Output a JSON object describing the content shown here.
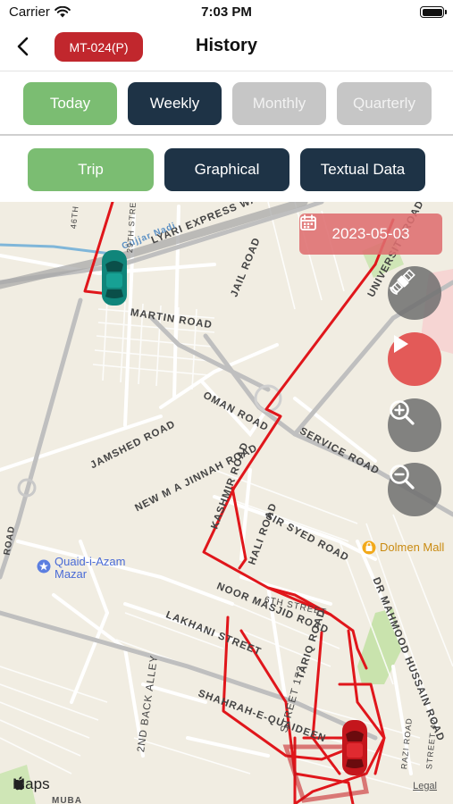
{
  "status_bar": {
    "carrier": "Carrier",
    "time": "7:03 PM"
  },
  "nav": {
    "vehicle_id": "MT-024(P)",
    "title": "History"
  },
  "period_tabs": [
    "Today",
    "Weekly",
    "Monthly",
    "Quarterly"
  ],
  "mode_tabs": [
    "Trip",
    "Graphical",
    "Textual Data"
  ],
  "map": {
    "date": "2023-05-03",
    "labels": {
      "lyari_expressway": "LYARI EXPRESS WAY",
      "martin_road": "MARTIN ROAD",
      "jail_road": "JAIL ROAD",
      "university_road": "UNIVERSITY ROAD",
      "oman_road": "OMAN ROAD",
      "service_road": "SERVICE ROAD",
      "jamshed_road": "JAMSHED ROAD",
      "new_ma_jinnah_road": "NEW M A JINNAH ROAD",
      "kashmir_road": "KASHMIR ROAD",
      "sir_syed_road": "SIR SYED ROAD",
      "hali_road": "HALI ROAD",
      "noor_masjid_road": "NOOR MASJID ROAD",
      "lakhani_street": "LAKHANI STREET",
      "tariq_road": "TARIQ ROAD",
      "street_173": "STREET 173",
      "dr_mahmood_hussain_road": "DR MAHMOOD HUSSAIN ROAD",
      "back_alley": "2ND BACK ALLEY",
      "shahrah": "SHAHRAH-E-QUAIDEEN",
      "twenty_ninth_street": "29TH STREET",
      "forty_sixth": "46TH",
      "road_a": "ROAD",
      "sixth_street": "6TH STREET",
      "razi_road": "RAZI ROAD",
      "street_42": "STREET 42",
      "mubarak": "MUBA",
      "nadi": "Gujjar Nadi"
    },
    "poi": {
      "mazar": "Quaid-i-Azam Mazar",
      "dolmen": "Dolmen Mall"
    },
    "attribution": {
      "maps": "Maps",
      "legal": "Legal"
    }
  },
  "colors": {
    "accent_red": "#c1272d",
    "active_green": "#7bbd72",
    "dark_navy": "#1e3346",
    "inactive_gray": "#c6c6c6",
    "track_red": "#e0161b",
    "vehicle_start": "#10857a",
    "vehicle_end": "#c4161c"
  },
  "icons": {
    "back": "chevron-left-icon",
    "calendar": "calendar-icon",
    "satellite": "satellite-icon",
    "play": "play-icon",
    "zoom_in": "zoom-in-icon",
    "zoom_out": "zoom-out-icon"
  }
}
